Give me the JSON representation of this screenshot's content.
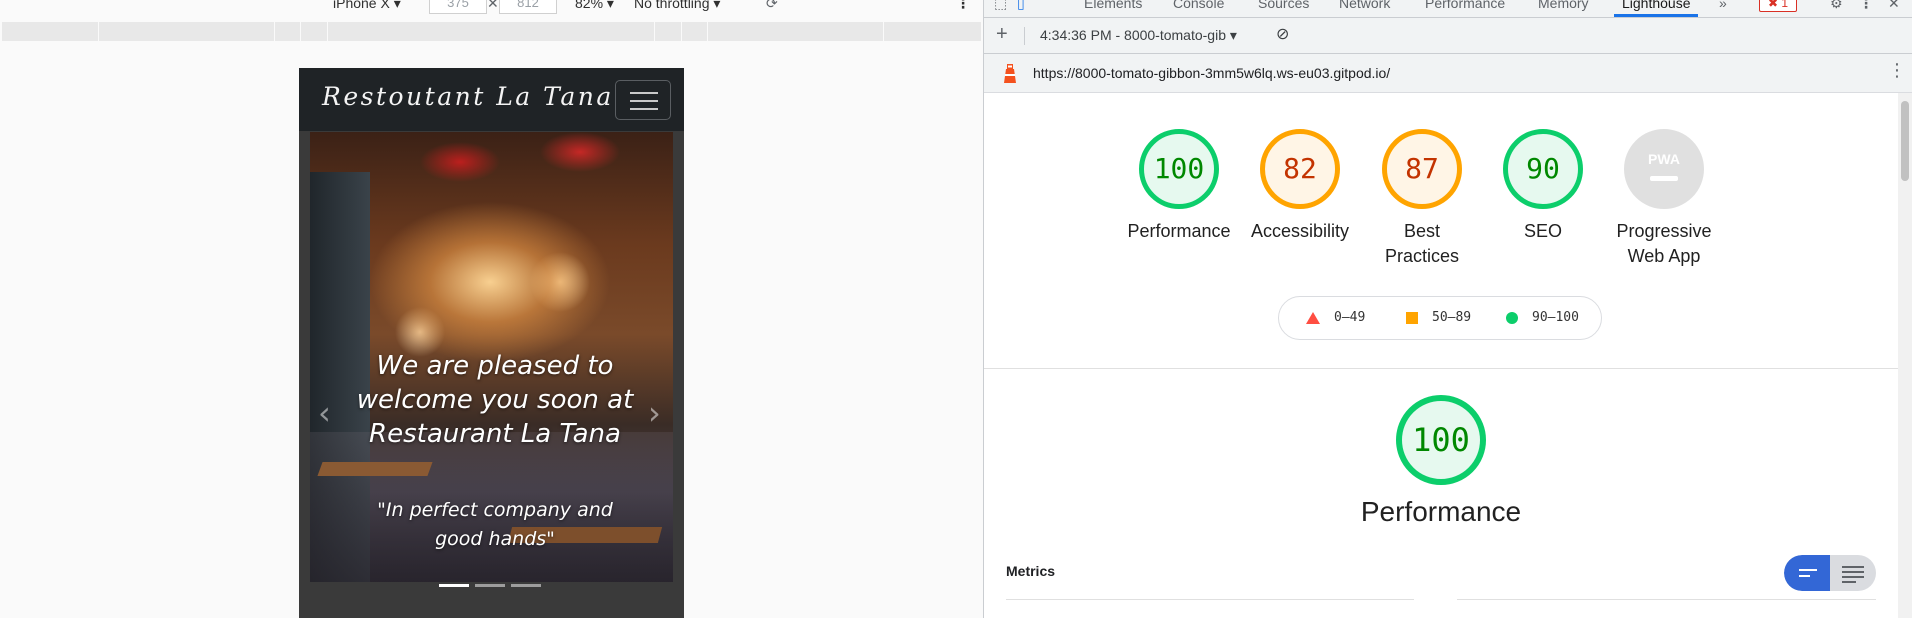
{
  "device_toolbar": {
    "device": "iPhone X",
    "width": "375",
    "height": "812",
    "zoom": "82%",
    "throttling": "No throttling"
  },
  "site": {
    "brand": "Restoutant La Tana",
    "caption_title": "We are pleased to welcome you soon at Restaurant La Tana",
    "caption_subtitle": "\"In perfect company and good hands\"",
    "carousel_slides": 3,
    "carousel_active": 1
  },
  "devtools": {
    "tabs": [
      "Elements",
      "Console",
      "Sources",
      "Network",
      "Performance",
      "Memory",
      "Lighthouse"
    ],
    "active_tab": "Lighthouse",
    "more_tabs": "»",
    "error_count": "1",
    "accent_color": "#1a73e8"
  },
  "lighthouse": {
    "report_select": "4:34:36 PM - 8000-tomato-gib",
    "url": "https://8000-tomato-gibbon-3mm5w6lq.ws-eu03.gitpod.io/",
    "gauges": [
      {
        "score": "100",
        "label": "Performance",
        "rating": "pass"
      },
      {
        "score": "82",
        "label": "Accessibility",
        "rating": "average"
      },
      {
        "score": "87",
        "label": "Best Practices",
        "rating": "average"
      },
      {
        "score": "90",
        "label": "SEO",
        "rating": "pass"
      },
      {
        "score": "PWA",
        "label": "Progressive Web App",
        "rating": "na"
      }
    ],
    "legend": [
      {
        "range": "0–49",
        "shape": "triangle",
        "color": "#ff4e42"
      },
      {
        "range": "50–89",
        "shape": "square",
        "color": "#ffa400"
      },
      {
        "range": "90–100",
        "shape": "circle",
        "color": "#0cce6b"
      }
    ],
    "category_score": "100",
    "category_title": "Performance",
    "metrics_title": "Metrics"
  }
}
